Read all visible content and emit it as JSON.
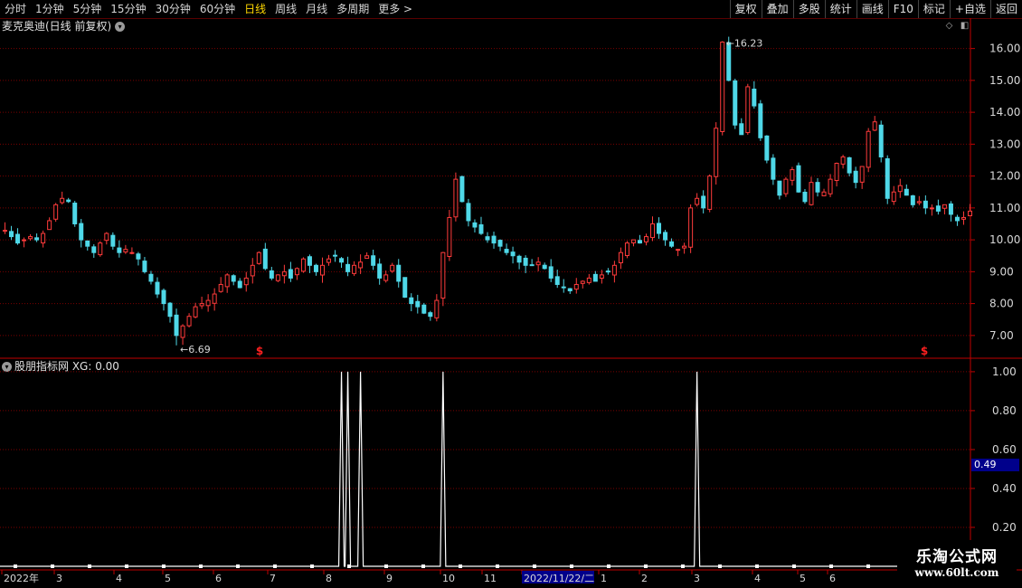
{
  "toolbar": {
    "periods": [
      {
        "label": "分时",
        "active": false
      },
      {
        "label": "1分钟",
        "active": false
      },
      {
        "label": "5分钟",
        "active": false
      },
      {
        "label": "15分钟",
        "active": false
      },
      {
        "label": "30分钟",
        "active": false
      },
      {
        "label": "60分钟",
        "active": false
      },
      {
        "label": "日线",
        "active": true
      },
      {
        "label": "周线",
        "active": false
      },
      {
        "label": "月线",
        "active": false
      },
      {
        "label": "多周期",
        "active": false
      },
      {
        "label": "更多 >",
        "active": false
      }
    ],
    "buttons": [
      "复权",
      "叠加",
      "多股",
      "统计",
      "画线",
      "F10",
      "标记",
      "+自选",
      "返回"
    ]
  },
  "price_pane": {
    "title": "麦克奥迪(日线 前复权)",
    "high_label": "16.23",
    "low_label": "6.69",
    "marker_symbol": "$"
  },
  "indicator_pane": {
    "title": "股朋指标网 XG: 0.00",
    "current_value": "0.49"
  },
  "watermark": {
    "name": "乐淘公式网",
    "url": "www.60lt.com"
  },
  "colors": {
    "up": "#ff3b3b",
    "down": "#4fd8e8",
    "grid": "#7a0000",
    "axis": "#c00000",
    "indicator_line": "#ffffff",
    "active_tab": "#ffd800",
    "date_highlight": "#00008b"
  },
  "chart_data": [
    {
      "type": "candlestick",
      "title": "麦克奥迪(日线 前复权)",
      "y_ticks": [
        7.0,
        8.0,
        9.0,
        10.0,
        11.0,
        12.0,
        13.0,
        14.0,
        15.0,
        16.0
      ],
      "y_tick_labels": [
        "7.00",
        "8.00",
        "9.00",
        "10.00",
        "11.00",
        "12.00",
        "13.00",
        "14.00",
        "15.00",
        "16.00"
      ],
      "ylim": [
        6.4,
        16.5
      ],
      "trend_close": [
        10.3,
        10.1,
        9.9,
        10.0,
        10.1,
        10.0,
        10.2,
        10.6,
        11.1,
        11.3,
        11.2,
        10.5,
        10.0,
        9.8,
        9.6,
        9.9,
        10.2,
        9.8,
        9.6,
        9.7,
        9.6,
        9.4,
        9.0,
        8.7,
        8.3,
        8.0,
        7.6,
        7.0,
        7.3,
        7.6,
        7.9,
        8.0,
        8.1,
        8.3,
        8.6,
        8.9,
        8.7,
        8.5,
        8.8,
        9.2,
        9.6,
        9.1,
        8.8,
        8.9,
        9.0,
        8.8,
        9.1,
        9.4,
        9.2,
        9.0,
        9.2,
        9.4,
        9.5,
        9.3,
        9.0,
        9.2,
        9.3,
        9.5,
        9.2,
        8.8,
        8.9,
        9.2,
        8.7,
        8.2,
        8.0,
        7.9,
        7.7,
        7.6,
        8.1,
        9.6,
        10.7,
        11.9,
        11.2,
        10.6,
        10.4,
        10.2,
        10.0,
        9.9,
        9.8,
        9.6,
        9.5,
        9.3,
        9.2,
        9.2,
        9.3,
        9.1,
        8.8,
        8.6,
        8.5,
        8.4,
        8.6,
        8.7,
        8.8,
        8.7,
        8.9,
        9.0,
        9.2,
        9.6,
        9.9,
        10.0,
        9.9,
        10.1,
        10.5,
        10.2,
        10.0,
        9.8,
        9.7,
        9.8,
        11.0,
        11.3,
        11.0,
        12.0,
        13.5,
        16.2,
        15.0,
        13.6,
        13.3,
        14.8,
        14.2,
        13.2,
        12.5,
        11.9,
        11.4,
        11.9,
        12.2,
        11.5,
        11.2,
        11.8,
        11.5,
        11.5,
        11.9,
        12.4,
        12.6,
        12.1,
        11.8,
        12.3,
        13.4,
        13.7,
        12.6,
        11.3,
        11.5,
        11.7,
        11.4,
        11.1,
        11.2,
        11.0,
        11.0,
        10.9,
        11.1,
        10.8,
        10.6,
        10.7,
        10.9
      ],
      "annotations": [
        {
          "text": "16.23",
          "value": 16.23
        },
        {
          "text": "6.69",
          "value": 6.69
        }
      ]
    },
    {
      "type": "line",
      "title": "股朋指标网 XG: 0.00",
      "y_ticks": [
        0.2,
        0.4,
        0.6,
        0.8,
        1.0
      ],
      "y_tick_labels": [
        "0.20",
        "0.40",
        "0.60",
        "0.80",
        "1.00"
      ],
      "ylim": [
        0,
        1.06
      ],
      "series": [
        {
          "values_spikes_at_bar": [
            53,
            54,
            56,
            69,
            109
          ],
          "baseline": 0,
          "peak": 1.0
        }
      ]
    }
  ],
  "x_axis": {
    "labels": [
      "2022年",
      "3",
      "4",
      "5",
      "6",
      "7",
      "8",
      "9",
      "10",
      "11",
      "2022/11/22/二",
      "1",
      "2",
      "3",
      "4",
      "5",
      "6"
    ],
    "highlight_label": "2022/11/22/二"
  }
}
